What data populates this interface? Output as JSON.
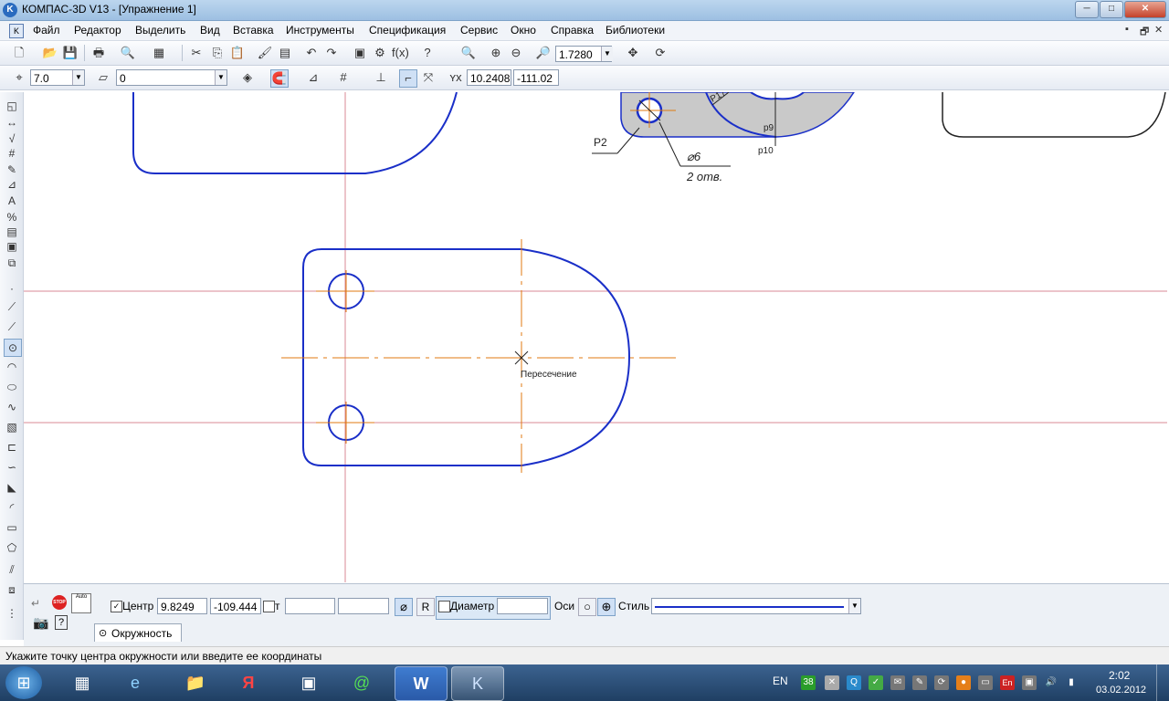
{
  "window": {
    "title": "КОМПАС-3D V13 - [Упражнение 1]",
    "app_icon": "K",
    "minimize": "─",
    "maximize": "□",
    "close": "✕"
  },
  "menu": [
    "Файл",
    "Редактор",
    "Выделить",
    "Вид",
    "Вставка",
    "Инструменты",
    "Спецификация",
    "Сервис",
    "Окно",
    "Справка",
    "Библиотеки"
  ],
  "mdi_controls": [
    "▪",
    "🗗",
    "✕"
  ],
  "toolbar1": {
    "zoom_value": "1.7280"
  },
  "toolbar2": {
    "step_value": "7.0",
    "layer_value": "0",
    "coord_x": "10.2408",
    "coord_y": "-111.02"
  },
  "canvas": {
    "label_intersection": "Пересечение",
    "label_r2": "Р2",
    "label_diam6": "⌀6",
    "label_holes": "2 отв.",
    "label_r9": "р9",
    "label_r10": "р10",
    "label_r17": "Р17"
  },
  "props": {
    "center_label": "Центр",
    "center_x": "9.8249",
    "center_y": "-109.444",
    "point_label": "т",
    "point_x": "",
    "point_y": "",
    "diam_btn": "⌀",
    "radius_btn": "R",
    "diameter_label": "Диаметр",
    "diameter_value": "",
    "axes_label": "Оси",
    "style_label": "Стиль",
    "tab_label": "Окружность",
    "stop_label": "STOP",
    "auto_label": "Auto"
  },
  "status": "Укажите точку центра окружности или введите ее координаты",
  "taskbar": {
    "lang": "EN",
    "time": "2:02",
    "date": "03.02.2012",
    "tray_num": "38",
    "tray_en": "En"
  },
  "colors": {
    "geometry": "#1a2fc8",
    "axis": "#e07a10",
    "guide": "#d88a96",
    "black": "#222222"
  }
}
